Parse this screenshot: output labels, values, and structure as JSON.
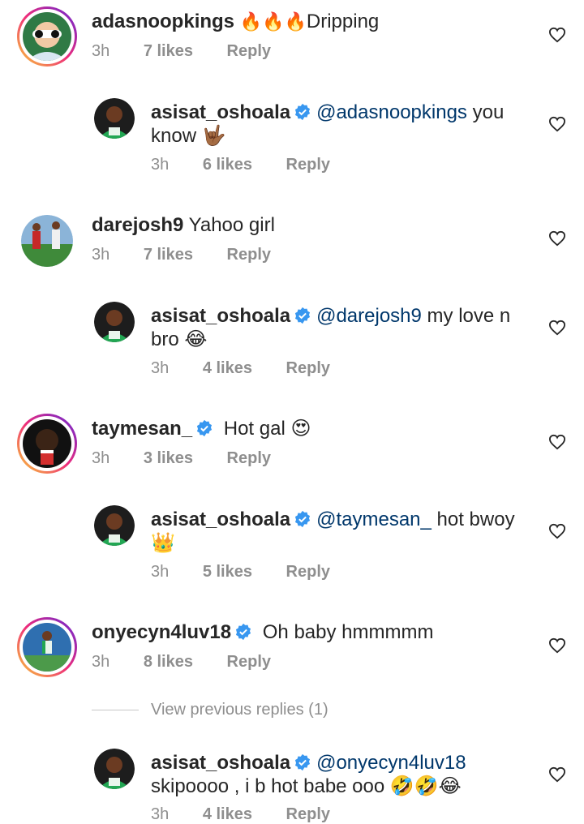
{
  "comments": [
    {
      "username": "adasnoopkings",
      "emoji": "🔥🔥🔥",
      "text": "Dripping",
      "time": "3h",
      "likes": "7 likes",
      "reply": "Reply",
      "replies": [
        {
          "username": "asisat_oshoala",
          "mention": "@adasnoopkings",
          "text_line1": " you",
          "text_line2": "know 🤟🏾",
          "time": "3h",
          "likes": "6 likes",
          "reply": "Reply"
        }
      ]
    },
    {
      "username": "darejosh9",
      "text": "Yahoo girl",
      "time": "3h",
      "likes": "7 likes",
      "reply": "Reply",
      "replies": [
        {
          "username": "asisat_oshoala",
          "mention": "@darejosh9",
          "text_line1": " my love n",
          "text_line2": "bro 😂",
          "time": "3h",
          "likes": "4 likes",
          "reply": "Reply"
        }
      ]
    },
    {
      "username": "taymesan_",
      "text": "Hot gal 😍",
      "time": "3h",
      "likes": "3 likes",
      "reply": "Reply",
      "replies": [
        {
          "username": "asisat_oshoala",
          "mention": "@taymesan_",
          "text_line1": " hot bwoy",
          "text_line2": "👑",
          "time": "3h",
          "likes": "5 likes",
          "reply": "Reply"
        }
      ]
    },
    {
      "username": "onyecyn4luv18",
      "text": "Oh baby hmmmmm",
      "time": "3h",
      "likes": "8 likes",
      "reply": "Reply",
      "view_previous": "View previous replies (1)",
      "replies": [
        {
          "username": "asisat_oshoala",
          "mention": "@onyecyn4luv18",
          "text_line1": "",
          "text_line2": "skipoooo , i b hot babe ooo 🤣🤣😂",
          "time": "3h",
          "likes": "4 likes",
          "reply": "Reply"
        }
      ]
    }
  ],
  "colors": {
    "username": "#262626",
    "mention": "#00376b",
    "meta": "#8e8e8e",
    "verified": "#3897f0"
  },
  "icons": {
    "like": "heart-outline-icon",
    "verified": "verified-badge-icon"
  }
}
